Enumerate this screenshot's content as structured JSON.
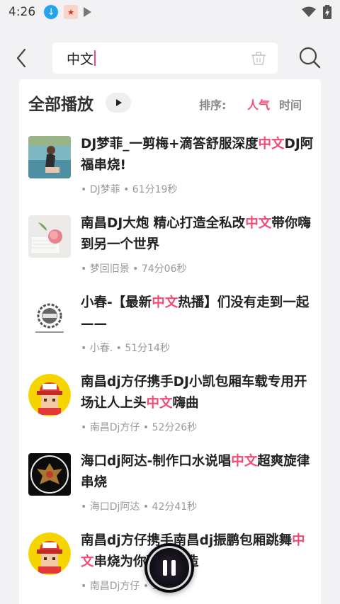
{
  "status": {
    "time": "4:26"
  },
  "search": {
    "query": "中文"
  },
  "list": {
    "title": "全部播放",
    "sort_label": "排序:",
    "sort_popular": "人气",
    "sort_time": "时间"
  },
  "songs": [
    {
      "title_a": "DJ梦菲_一剪梅+滴答舒服深度",
      "title_hl": "中文",
      "title_b": "DJ阿福串烧!",
      "meta": "• DJ梦菲 • 61分19秒"
    },
    {
      "title_a": "南昌DJ大炮  精心打造全私改",
      "title_hl": "中文",
      "title_b": "带你嗨到另一个世界",
      "meta": "• 梦回旧景 • 74分06秒"
    },
    {
      "title_a": "小春-【最新",
      "title_hl": "中文",
      "title_b": "热播】们没有走到一起 ——",
      "meta": "• 小春. • 51分14秒"
    },
    {
      "title_a": "南昌dj方仔携手DJ小凯包厢车载专用开场让人上头",
      "title_hl": "中文",
      "title_b": "嗨曲",
      "meta": "• 南昌Dj方仔 • 52分26秒"
    },
    {
      "title_a": "海口dj阿达-制作口水说唱",
      "title_hl": "中文",
      "title_b": "超爽旋律串烧",
      "meta": "• 海口Dj阿达 • 42分41秒"
    },
    {
      "title_a": "南昌dj方仔携手南昌dj振鹏包厢跳舞",
      "title_hl": "中文",
      "title_b": "串烧为你精心打造",
      "meta": "• 南昌Dj方仔 • 51分秒"
    }
  ],
  "colors": {
    "accent": "#f04c75",
    "background": "#f2f2f4"
  },
  "icons": [
    "back-icon",
    "search-icon",
    "clear-icon",
    "play-icon",
    "pause-icon",
    "wifi-icon",
    "battery-icon",
    "download-icon"
  ]
}
